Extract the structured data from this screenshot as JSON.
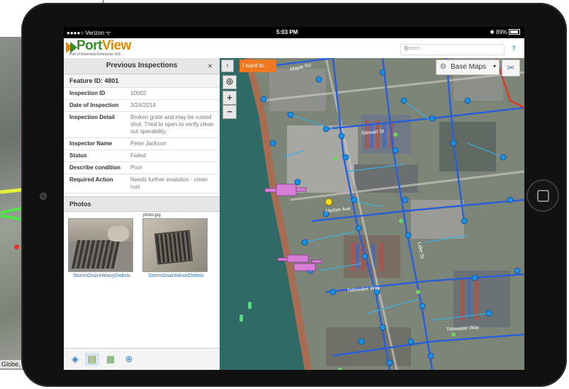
{
  "background": {
    "attribution": "Globe,"
  },
  "statusbar": {
    "carrier": "●●●●○ Verizon ᯤ",
    "time": "5:03 PM",
    "battery": "✱ 89%"
  },
  "header": {
    "logo_main": "Port",
    "logo_accent": "View",
    "logo_subtitle": "Port of Riverview Enterprise GIS",
    "search_placeholder": "Search..."
  },
  "panel": {
    "title": "Previous Inspections",
    "close": "×",
    "feature_id": "Feature ID: 4801",
    "rows": [
      {
        "label": "Inspection ID",
        "value": "10002"
      },
      {
        "label": "Date of Inspection",
        "value": "3/24/2014"
      },
      {
        "label": "Inspection Detail",
        "value": "Broken grate and may be rusted shut. Tried to open to verify clean out operability."
      },
      {
        "label": "Inspector Name",
        "value": "Peter Jackson"
      },
      {
        "label": "Status",
        "value": "Failed"
      },
      {
        "label": "Describe condition",
        "value": "Poor"
      },
      {
        "label": "Required Action",
        "value": "Needs further evalution - clean rust"
      }
    ],
    "photos_heading": "Photos",
    "photos": [
      {
        "caption": "StormDrainHeavyDebris"
      },
      {
        "caption": "StormDrainMinorDebris",
        "filename": "photo.jpg"
      }
    ]
  },
  "map": {
    "iwant": "I want to...",
    "basemaps": "Base Maps",
    "collapse": "‹",
    "zoom_in": "+",
    "zoom_out": "−",
    "streets": [
      "Maple Rd",
      "Stewart St",
      "Harbor Ave",
      "Tidewater Way",
      "Tidewater Way",
      "Lake St"
    ],
    "colors": {
      "water": "#2f6a66",
      "line": "#2a5fd8",
      "node": "#1f8fe6",
      "service": "#3ab0e0",
      "highlight": "#f0e020",
      "vessel": "#d77fd8",
      "green_node": "#6dd46b"
    }
  },
  "colors": {
    "logo_green": "#3a8d2e",
    "logo_orange": "#e08a00",
    "accent_orange": "#f07820",
    "link_blue": "#2e6fb8"
  }
}
